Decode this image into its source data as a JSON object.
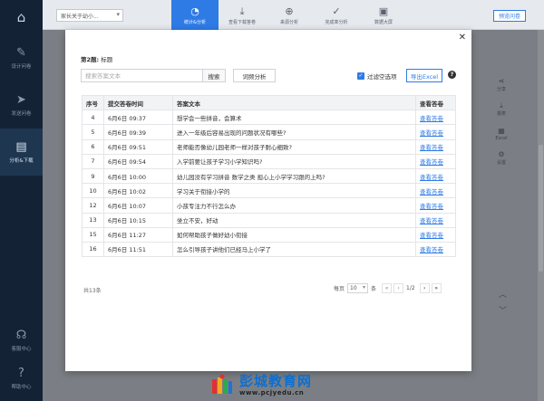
{
  "sidebar": {
    "items": [
      {
        "label": "设计问卷",
        "icon": "edit-doc-icon"
      },
      {
        "label": "发送问卷",
        "icon": "send-plane-icon"
      },
      {
        "label": "分析&下载",
        "icon": "chart-icon"
      }
    ],
    "bottom": [
      {
        "label": "客服中心",
        "icon": "headset-icon"
      },
      {
        "label": "帮助中心",
        "icon": "help-icon"
      }
    ]
  },
  "topbar": {
    "survey_select": "家长关于幼小...",
    "tabs": [
      {
        "label": "统计&分析",
        "icon": "pie-chart-icon"
      },
      {
        "label": "查看下载答卷",
        "icon": "download-icon"
      },
      {
        "label": "来源分析",
        "icon": "target-icon"
      },
      {
        "label": "完成率分析",
        "icon": "check-circle-icon"
      },
      {
        "label": "数据大屏",
        "icon": "monitor-icon"
      }
    ],
    "preview_label": "预览问卷"
  },
  "right_tools": [
    {
      "label": "分享",
      "icon": "share-icon"
    },
    {
      "label": "报表",
      "icon": "download-icon"
    },
    {
      "label": "Excel",
      "icon": "excel-icon"
    },
    {
      "label": "设置",
      "icon": "gear-icon"
    }
  ],
  "modal": {
    "question_label": "第2题:",
    "question_title": "标题",
    "search_placeholder": "搜索答案文本",
    "search_label": "搜索",
    "wordcloud_label": "词频分析",
    "filter_label": "过滤空选项",
    "export_label": "导出Excel",
    "headers": [
      "序号",
      "提交答卷时间",
      "答案文本",
      "查看答卷"
    ],
    "rows": [
      {
        "no": "4",
        "time": "6月6日 09:37",
        "text": "想学会一些拼音，会算术",
        "view": "查看答卷"
      },
      {
        "no": "5",
        "time": "6月6日 09:39",
        "text": "进入一年级后容易出现的问题状况有哪些?",
        "view": "查看答卷"
      },
      {
        "no": "6",
        "time": "6月6日 09:51",
        "text": "老师能否像幼儿园老师一样对孩子耐心细致?",
        "view": "查看答卷"
      },
      {
        "no": "7",
        "time": "6月6日 09:54",
        "text": "入学前要让孩子学习小学知识吗?",
        "view": "查看答卷"
      },
      {
        "no": "9",
        "time": "6月6日 10:00",
        "text": "幼儿园没有学习拼音 数学之类 担心上小学学习跟的上吗?",
        "view": "查看答卷"
      },
      {
        "no": "10",
        "time": "6月6日 10:02",
        "text": "学习关于衔接小学的",
        "view": "查看答卷"
      },
      {
        "no": "12",
        "time": "6月6日 10:07",
        "text": "小孩专注力不行怎么办",
        "view": "查看答卷"
      },
      {
        "no": "13",
        "time": "6月6日 10:15",
        "text": "坐立不安，好动",
        "view": "查看答卷"
      },
      {
        "no": "15",
        "time": "6月6日 11:27",
        "text": "如何帮助孩子做好幼小衔接",
        "view": "查看答卷"
      },
      {
        "no": "16",
        "time": "6月6日 11:51",
        "text": "怎么引导孩子讲他们已经马上小学了",
        "view": "查看答卷"
      }
    ],
    "total": "共13条",
    "per_page_label": "每页",
    "per_page_value": "10",
    "per_page_unit": "条",
    "page_info": "1/2"
  },
  "watermark": {
    "title": "彭城教育网",
    "url": "www.pcjyedu.cn"
  }
}
